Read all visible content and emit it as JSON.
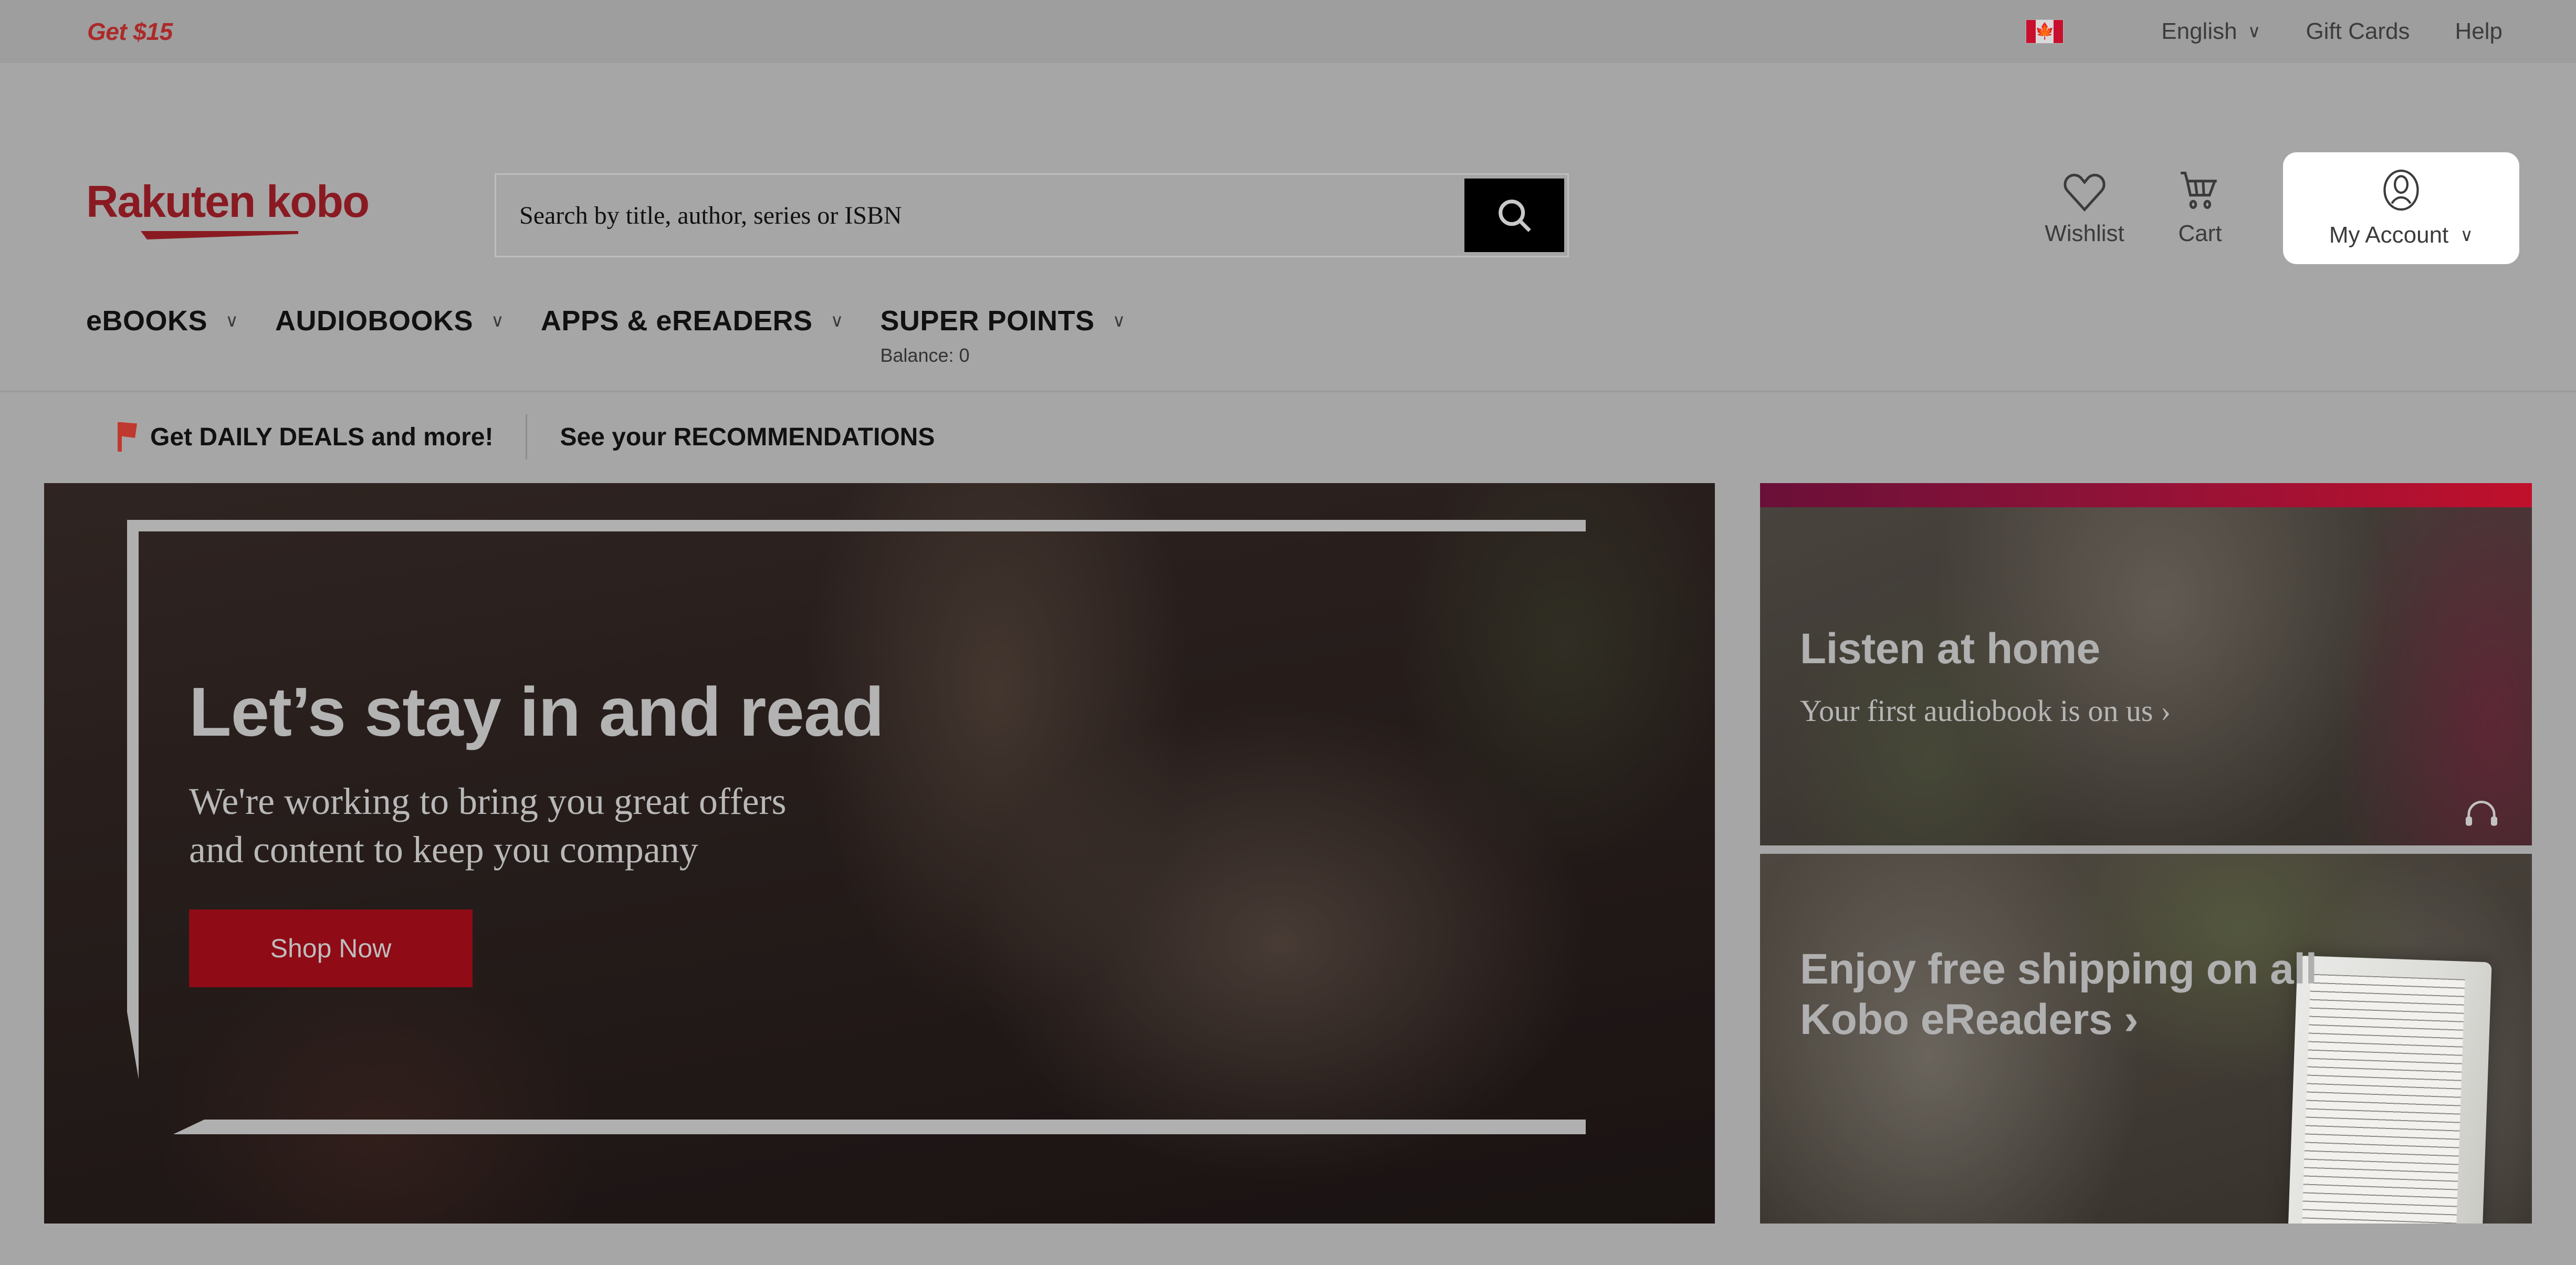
{
  "utility_bar": {
    "promo_label": "Get $15",
    "country_flag": "canada-flag-icon",
    "language": "English",
    "gift_cards": "Gift Cards",
    "help": "Help"
  },
  "header": {
    "logo_text": "Rakuten kobo",
    "search": {
      "placeholder": "Search by title, author, series or ISBN",
      "value": "",
      "button_icon": "search-icon"
    },
    "account": {
      "wishlist_label": "Wishlist",
      "wishlist_icon": "heart-icon",
      "cart_label": "Cart",
      "cart_icon": "shopping-cart-icon",
      "my_account_label": "My Account",
      "my_account_icon": "user-avatar-icon",
      "my_account_chevron": "chevron-down-icon"
    }
  },
  "nav": {
    "items": [
      {
        "label": "eBOOKS",
        "chevron": "chevron-down-icon",
        "sub": ""
      },
      {
        "label": "AUDIOBOOKS",
        "chevron": "chevron-down-icon",
        "sub": ""
      },
      {
        "label": "APPS & eREADERS",
        "chevron": "chevron-down-icon",
        "sub": ""
      },
      {
        "label": "SUPER POINTS",
        "chevron": "chevron-down-icon",
        "sub": "Balance: 0"
      }
    ]
  },
  "promo_bar": {
    "flag_icon": "red-flag-icon",
    "daily_deals": "Get DAILY DEALS and more!",
    "recommendations": "See your RECOMMENDATIONS"
  },
  "hero": {
    "title": "Let’s stay in and read",
    "subtitle": "We're working to bring you great offers and content to keep you company",
    "cta_label": "Shop Now"
  },
  "tiles": [
    {
      "title": "Listen at home",
      "subtitle": "Your first audiobook is on us ›",
      "icon": "headphones-icon",
      "accent": "#c0102c"
    },
    {
      "title": "Enjoy free shipping on all Kobo eReaders ›",
      "subtitle": "",
      "icon": "ereader-icon",
      "accent": "#8f0b16"
    }
  ],
  "colors": {
    "page_background": "#a6a6a6",
    "brand_red": "#8a1a22",
    "cta_red": "#8f0b16",
    "accent_magenta": "#c0102c",
    "text_dark": "#111111"
  }
}
